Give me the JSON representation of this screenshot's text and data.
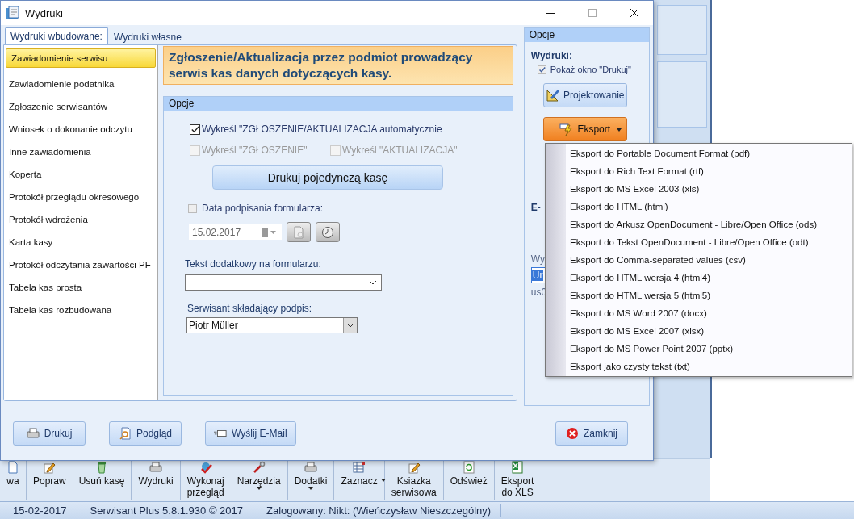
{
  "window": {
    "title": "Wydruki"
  },
  "tabs": [
    {
      "label": "Wydruki wbudowane:",
      "selected": true
    },
    {
      "label": "Wydruki własne",
      "selected": false
    }
  ],
  "print_list": [
    {
      "label": "Zawiadomienie serwisu",
      "selected": true
    },
    {
      "label": "Zawiadomienie podatnika",
      "selected": false
    },
    {
      "label": "Zgłoszenie serwisantów",
      "selected": false
    },
    {
      "label": "Wniosek o dokonanie odczytu",
      "selected": false
    },
    {
      "label": "Inne zawiadomienia",
      "selected": false
    },
    {
      "label": "Koperta",
      "selected": false
    },
    {
      "label": "Protokół przeglądu okresowego",
      "selected": false
    },
    {
      "label": "Protokół wdrożenia",
      "selected": false
    },
    {
      "label": "Karta kasy",
      "selected": false
    },
    {
      "label": "Protokół odczytania zawartości PF",
      "selected": false
    },
    {
      "label": "Tabela kas prosta",
      "selected": false
    },
    {
      "label": "Tabela kas rozbudowana",
      "selected": false
    }
  ],
  "heading": "Zgłoszenie/Aktualizacja przez podmiot prowadzący serwis kas danych dotyczących kasy.",
  "options": {
    "title": "Opcje",
    "auto_checkbox": {
      "label": "Wykreśl \"ZGŁOSZENIE/AKTUALIZACJA automatycznie",
      "checked": true
    },
    "strike_checkboxes": [
      {
        "label": "Wykreśl \"ZGŁOSZENIE\"",
        "checked": false,
        "disabled": true
      },
      {
        "label": "Wykreśl \"AKTUALIZACJA\"",
        "checked": false,
        "disabled": true
      }
    ],
    "print_single_button": "Drukuj pojedynczą kasę",
    "date_checkbox": {
      "label": "Data podpisania formularza:",
      "checked": false
    },
    "date_field": "15.02.2017",
    "extra_text_label": "Tekst dodatkowy na formularzu:",
    "technician_label": "Serwisant składający podpis:",
    "technician_value": "Piotr Müller"
  },
  "side_panel": {
    "title": "Opcje",
    "section": "Wydruki:",
    "show_print_checkbox": {
      "label": "Pokaż okno \"Drukuj\"",
      "checked": true
    },
    "design_button": "Projektowanie",
    "export_button": "Eksport",
    "email_heading": "E-",
    "send_label": "Wy",
    "address_value": "Ur",
    "address_note": "us0"
  },
  "export_menu": [
    {
      "label": "Eksport do Portable Document Format (pdf)"
    },
    {
      "label": "Eksport do Rich Text Format (rtf)"
    },
    {
      "label": "Eksport do MS Excel 2003 (xls)"
    },
    {
      "label": "Eksport do HTML (html)"
    },
    {
      "label": "Eksport do Arkusz OpenDocument - Libre/Open Office (ods)"
    },
    {
      "label": "Eksport do Tekst OpenDocument - Libre/Open Office (odt)"
    },
    {
      "label": "Eksport do Comma-separated values (csv)"
    },
    {
      "label": "Eksport do HTML wersja 4 (html4)"
    },
    {
      "label": "Eksport do HTML wersja 5 (html5)"
    },
    {
      "label": "Eksport do MS Word 2007 (docx)"
    },
    {
      "label": "Eksport do MS Excel 2007 (xlsx)"
    },
    {
      "label": "Eksport do MS Power Point 2007 (pptx)"
    },
    {
      "label": "Eksport jako czysty tekst (txt)"
    }
  ],
  "footer_buttons": [
    {
      "label": "Drukuj",
      "kind": "printer"
    },
    {
      "label": "Podgląd",
      "kind": "preview"
    },
    {
      "label": "Wyślij E-Mail",
      "kind": "mail"
    },
    {
      "label": "Zamknij",
      "kind": "close"
    }
  ],
  "toolbar": [
    {
      "label": "wa",
      "caret_below": false,
      "caret_beside": false,
      "kind": "document"
    },
    {
      "label": "Popraw",
      "caret_below": false,
      "caret_beside": false,
      "kind": "pencil"
    },
    {
      "label": "Usuń kasę",
      "caret_below": false,
      "caret_beside": false,
      "kind": "bin"
    },
    {
      "label": "Wydruki",
      "caret_below": false,
      "caret_beside": false,
      "kind": "printer"
    },
    {
      "label": "Wykonaj\nprzegląd",
      "caret_below": false,
      "caret_beside": false,
      "kind": "check"
    },
    {
      "label": "Narzędzia",
      "caret_below": true,
      "caret_beside": false,
      "kind": "tools"
    },
    {
      "label": "Dodatki",
      "caret_below": true,
      "caret_beside": false,
      "kind": "printer"
    },
    {
      "label": "Zaznacz",
      "caret_below": false,
      "caret_beside": true,
      "kind": "grid"
    },
    {
      "label": "Ksiazka\nserwisowa",
      "caret_below": false,
      "caret_beside": false,
      "kind": "pencil"
    },
    {
      "label": "Odśwież",
      "caret_below": false,
      "caret_beside": false,
      "kind": "refresh"
    },
    {
      "label": "Eksport\ndo XLS",
      "caret_below": false,
      "caret_beside": false,
      "kind": "sheet"
    }
  ],
  "status_bar": [
    "15-02-2017",
    "Serwisant Plus 5.8.1.930 © 2017",
    "Zalogowany: Nikt: (Wieńczysław Nieszczególny)"
  ]
}
